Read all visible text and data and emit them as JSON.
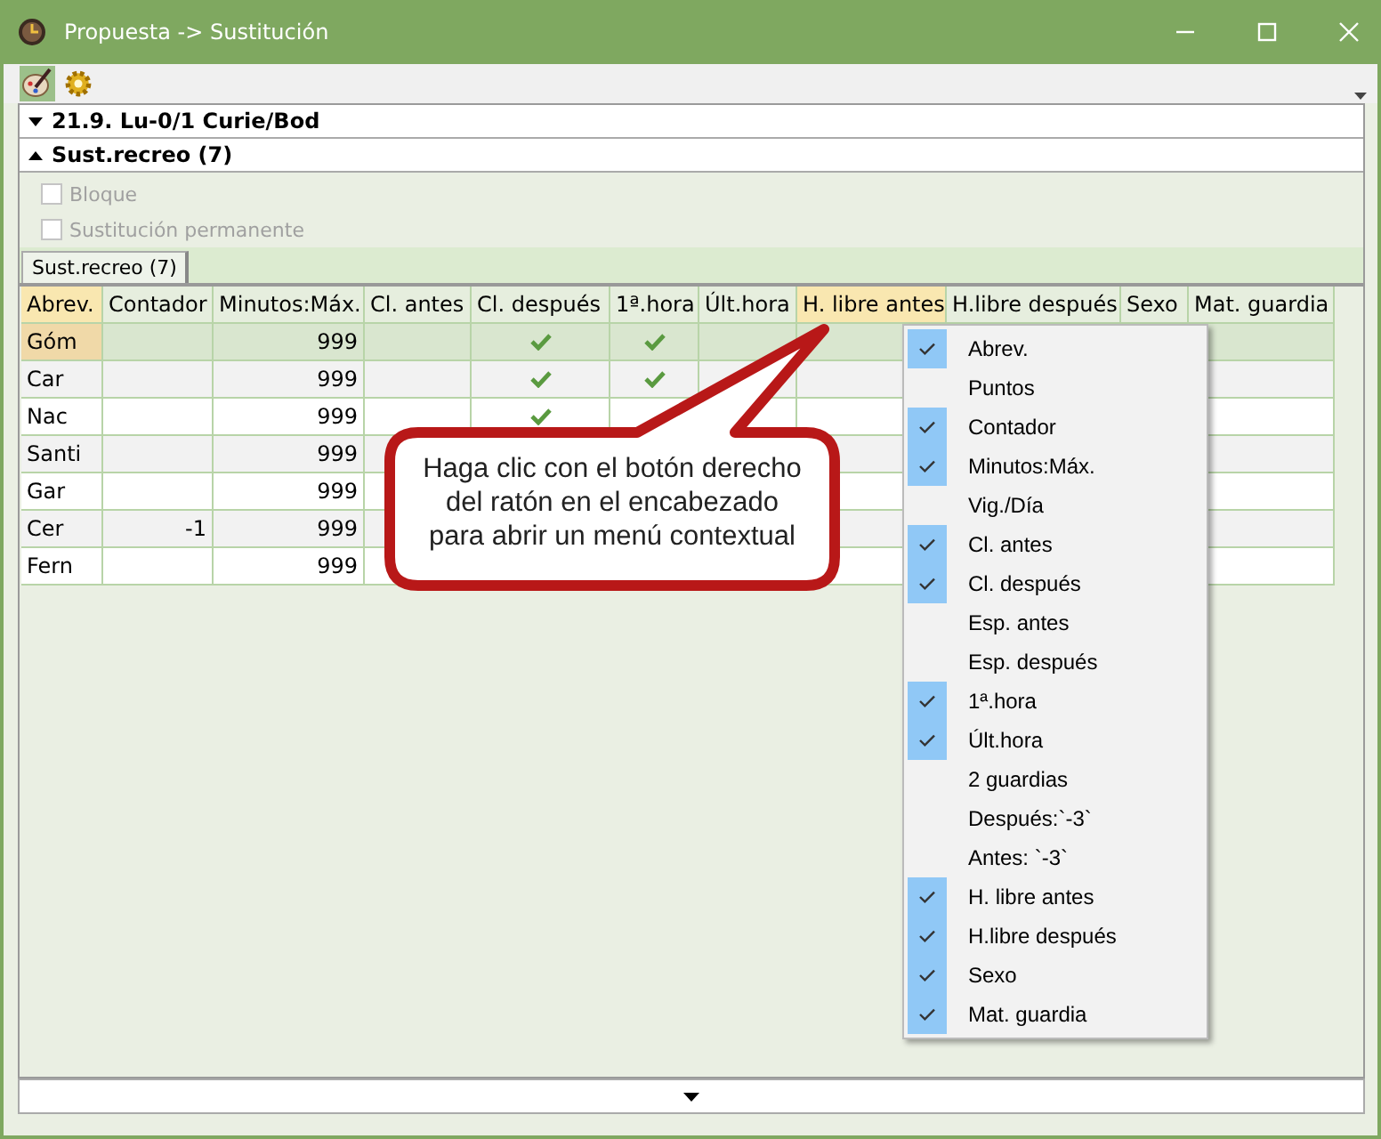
{
  "window": {
    "title": "Propuesta -> Sustitución"
  },
  "sections": [
    {
      "label": "21.9. Lu-0/1 Curie/Bod",
      "expanded": false
    },
    {
      "label": "Sust.recreo (7)",
      "expanded": true
    }
  ],
  "options": [
    {
      "label": "Bloque",
      "checked": false,
      "disabled": true
    },
    {
      "label": "Sustitución permanente",
      "checked": false,
      "disabled": true
    }
  ],
  "tabs": [
    {
      "label": "Sust.recreo (7)",
      "selected": true
    }
  ],
  "table": {
    "columns": [
      {
        "label": "Abrev.",
        "highlighted": true
      },
      {
        "label": "Contador",
        "highlighted": false
      },
      {
        "label": "Minutos:Máx.",
        "highlighted": false
      },
      {
        "label": "Cl. antes",
        "highlighted": false
      },
      {
        "label": "Cl. después",
        "highlighted": false
      },
      {
        "label": "1ª.hora",
        "highlighted": false
      },
      {
        "label": "Últ.hora",
        "highlighted": false
      },
      {
        "label": "H. libre antes",
        "highlighted": true
      },
      {
        "label": "H.libre después",
        "highlighted": false
      },
      {
        "label": "Sexo",
        "highlighted": false
      },
      {
        "label": "Mat. guardia",
        "highlighted": false
      }
    ],
    "rows": [
      {
        "abrev": "Góm",
        "contador": "",
        "minutos": "999",
        "cl_despues": true,
        "primera_hora": true,
        "selected": true
      },
      {
        "abrev": "Car",
        "contador": "",
        "minutos": "999",
        "cl_despues": true,
        "primera_hora": true,
        "selected": false
      },
      {
        "abrev": "Nac",
        "contador": "",
        "minutos": "999",
        "cl_despues": true,
        "primera_hora": false,
        "selected": false
      },
      {
        "abrev": "Santi",
        "contador": "",
        "minutos": "999",
        "selected": false
      },
      {
        "abrev": "Gar",
        "contador": "",
        "minutos": "999",
        "selected": false
      },
      {
        "abrev": "Cer",
        "contador": "-1",
        "minutos": "999",
        "selected": false
      },
      {
        "abrev": "Fern",
        "contador": "",
        "minutos": "999",
        "selected": false
      }
    ]
  },
  "callout": {
    "text": "Haga clic con el botón derecho del ratón en el encabezado para abrir un menú contextual"
  },
  "context_menu": [
    {
      "label": "Abrev.",
      "checked": true
    },
    {
      "label": "Puntos",
      "checked": false
    },
    {
      "label": "Contador",
      "checked": true
    },
    {
      "label": "Minutos:Máx.",
      "checked": true
    },
    {
      "label": "Vig./Día",
      "checked": false
    },
    {
      "label": "Cl. antes",
      "checked": true
    },
    {
      "label": "Cl. después",
      "checked": true
    },
    {
      "label": "Esp. antes",
      "checked": false
    },
    {
      "label": "Esp. después",
      "checked": false
    },
    {
      "label": "1ª.hora",
      "checked": true
    },
    {
      "label": "Últ.hora",
      "checked": true
    },
    {
      "label": "2 guardias",
      "checked": false
    },
    {
      "label": "Después:`-3`",
      "checked": false
    },
    {
      "label": "Antes: `-3`",
      "checked": false
    },
    {
      "label": "H. libre antes",
      "checked": true
    },
    {
      "label": "H.libre después",
      "checked": true
    },
    {
      "label": "Sexo",
      "checked": true
    },
    {
      "label": "Mat. guardia",
      "checked": true
    }
  ]
}
